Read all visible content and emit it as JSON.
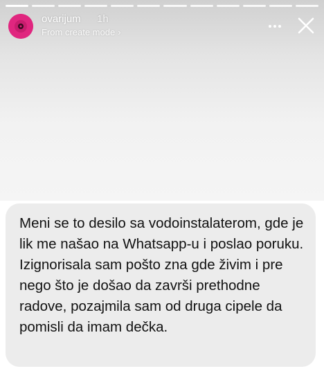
{
  "story": {
    "progress_segments": 12,
    "active_segment": 0
  },
  "header": {
    "username": "ovarijum",
    "time": "1h",
    "subtitle": "From create mode",
    "avatar_color": "#e0267f"
  },
  "icons": {
    "more": "more-dots-icon",
    "close": "close-icon",
    "subtitle_chevron": "chevron-right-icon"
  },
  "card": {
    "text": "Meni se to desilo sa vodoinstalaterom, gde je lik me našao na Whatsapp-u i poslao poruku. Izignorisala sam pošto zna gde živim i pre nego što je došao da završi prethodne radove, pozajmila sam od druga cipele da pomisli da imam dečka."
  }
}
